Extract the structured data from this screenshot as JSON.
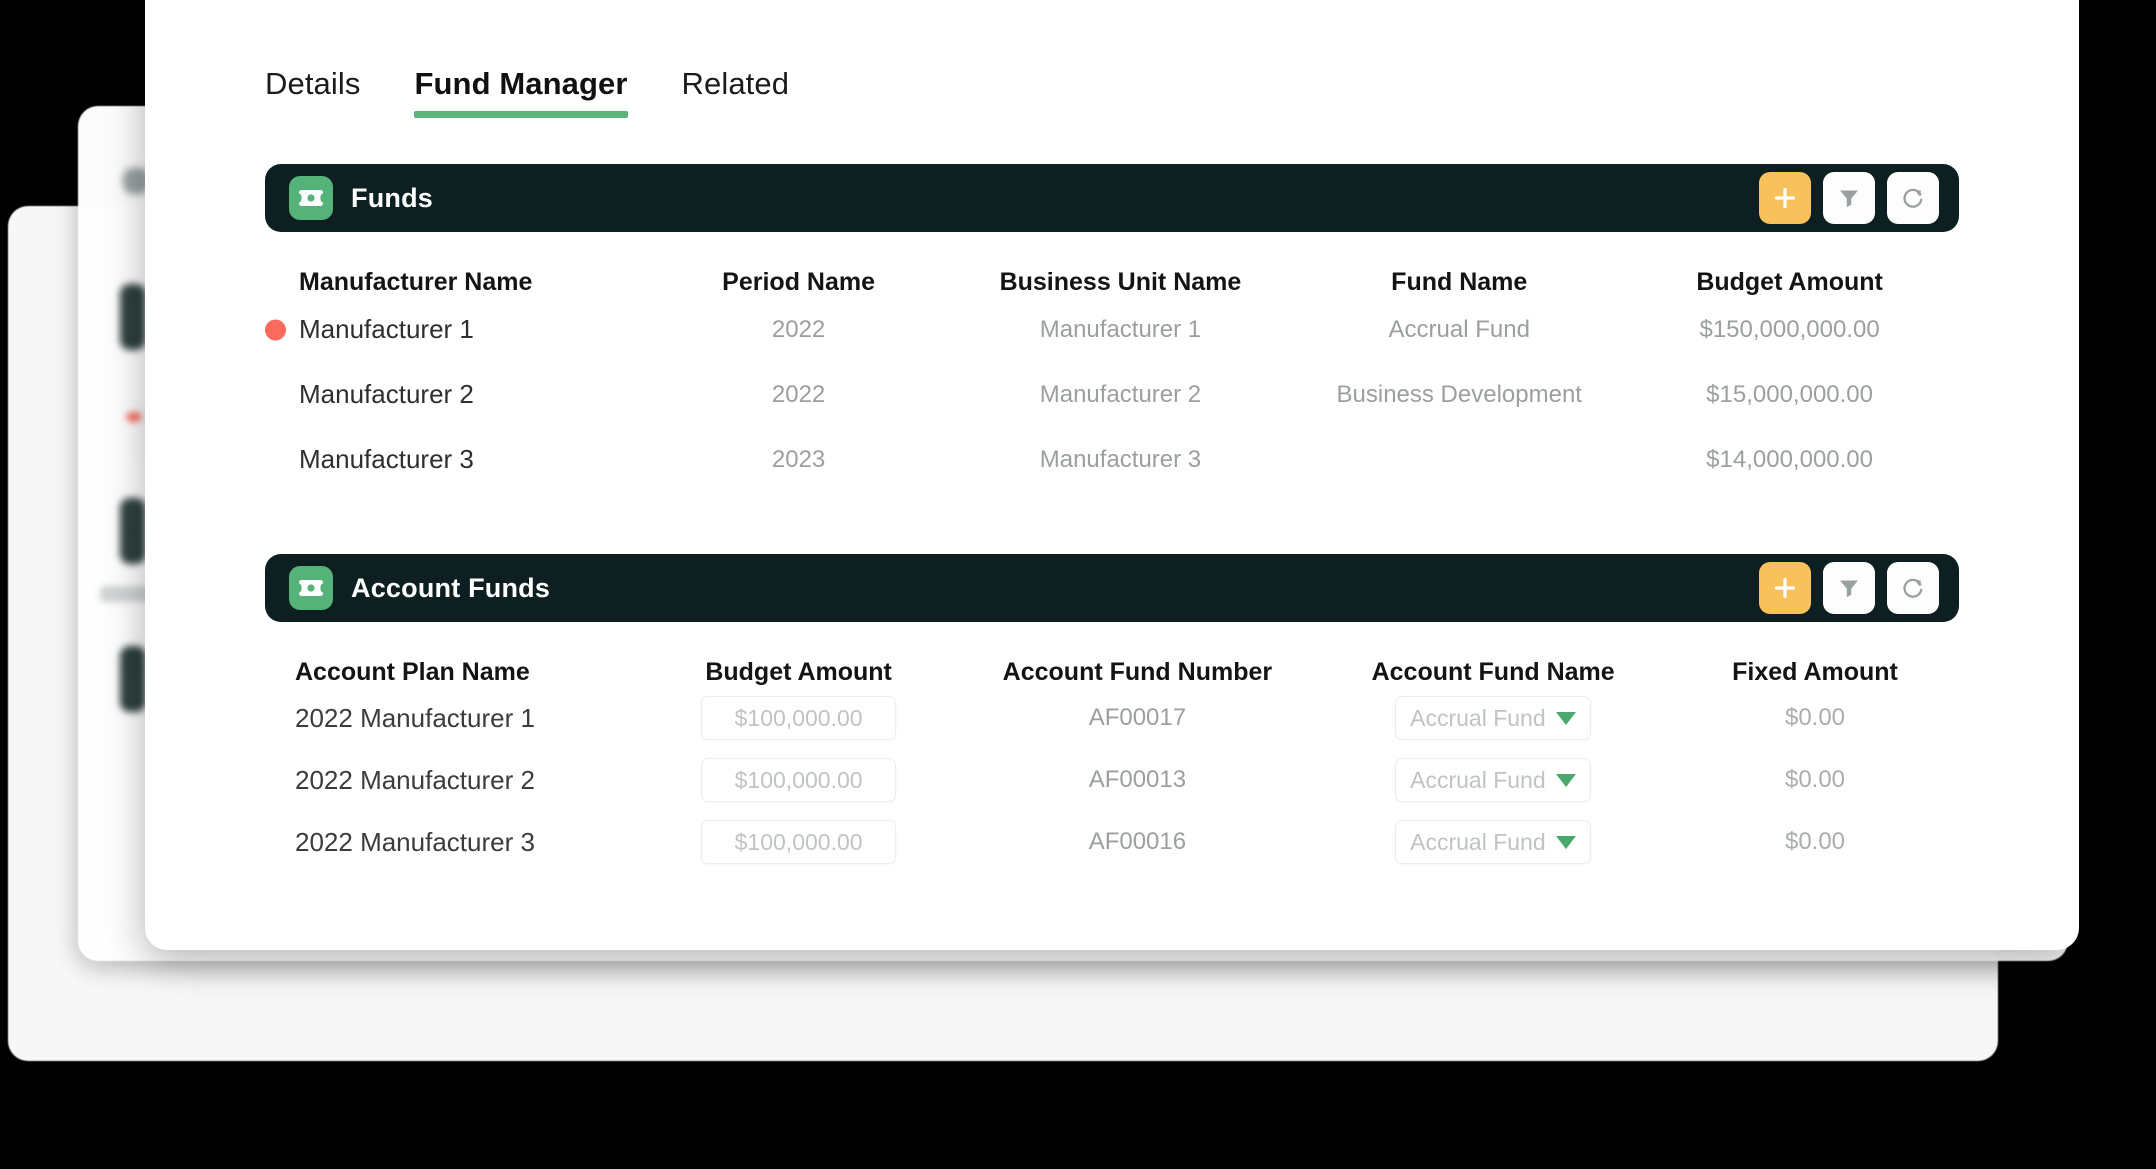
{
  "tabs": [
    {
      "label": "Details",
      "active": false
    },
    {
      "label": "Fund Manager",
      "active": true
    },
    {
      "label": "Related",
      "active": false
    }
  ],
  "colors": {
    "header_bar": "#0D1F20",
    "accent_green": "#55B37A",
    "add_button_amber": "#F8C15C",
    "status_dot_red": "#FA6B5E",
    "tab_underline_green": "#5BB37E",
    "canvas_black": "#000000"
  },
  "funds_section": {
    "title": "Funds",
    "icon": "money-bill-icon",
    "actions": [
      {
        "name": "add-fund-button",
        "icon": "plus-icon"
      },
      {
        "name": "filter-funds-button",
        "icon": "filter-icon"
      },
      {
        "name": "refresh-funds-button",
        "icon": "refresh-icon"
      }
    ],
    "columns": [
      "Manufacturer Name",
      "Period Name",
      "Business Unit Name",
      "Fund Name",
      "Budget Amount"
    ],
    "rows": [
      {
        "selected": true,
        "manufacturer_name": "Manufacturer 1",
        "period_name": "2022",
        "business_unit_name": "Manufacturer 1",
        "fund_name": "Accrual Fund",
        "budget_amount": "$150,000,000.00"
      },
      {
        "selected": false,
        "manufacturer_name": "Manufacturer 2",
        "period_name": "2022",
        "business_unit_name": "Manufacturer 2",
        "fund_name": "Business Development",
        "budget_amount": "$15,000,000.00"
      },
      {
        "selected": false,
        "manufacturer_name": "Manufacturer 3",
        "period_name": "2023",
        "business_unit_name": "Manufacturer 3",
        "fund_name": "",
        "budget_amount": "$14,000,000.00"
      }
    ]
  },
  "account_funds_section": {
    "title": "Account Funds",
    "icon": "money-bill-icon",
    "actions": [
      {
        "name": "add-account-fund-button",
        "icon": "plus-icon"
      },
      {
        "name": "filter-account-funds-button",
        "icon": "filter-icon"
      },
      {
        "name": "refresh-account-funds-button",
        "icon": "refresh-icon"
      }
    ],
    "columns": [
      "Account Plan Name",
      "Budget Amount",
      "Account Fund Number",
      "Account Fund Name",
      "Fixed Amount"
    ],
    "rows": [
      {
        "account_plan_name": "2022 Manufacturer 1",
        "budget_amount_placeholder": "$100,000.00",
        "account_fund_number": "AF00017",
        "account_fund_name": "Accrual Fund",
        "fixed_amount": "$0.00"
      },
      {
        "account_plan_name": "2022 Manufacturer 2",
        "budget_amount_placeholder": "$100,000.00",
        "account_fund_number": "AF00013",
        "account_fund_name": "Accrual Fund",
        "fixed_amount": "$0.00"
      },
      {
        "account_plan_name": "2022 Manufacturer 3",
        "budget_amount_placeholder": "$100,000.00",
        "account_fund_number": "AF00016",
        "account_fund_name": "Accrual Fund",
        "fixed_amount": "$0.00"
      }
    ]
  }
}
